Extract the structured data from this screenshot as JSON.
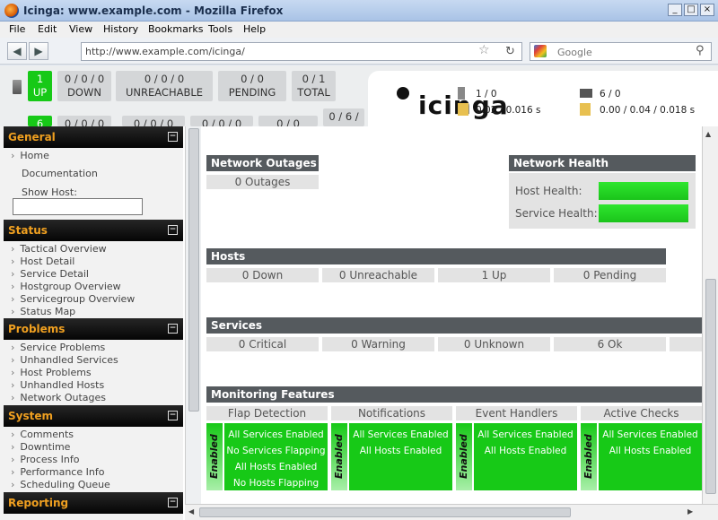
{
  "window": {
    "title": "Icinga: www.example.com - Mozilla Firefox"
  },
  "menubar": [
    "File",
    "Edit",
    "View",
    "History",
    "Bookmarks",
    "Tools",
    "Help"
  ],
  "nav": {
    "url": "http://www.example.com/icinga/",
    "search_placeholder": "Google"
  },
  "header": {
    "host_stats": [
      {
        "value": "1",
        "label": "UP"
      },
      {
        "value": "0 / 0 / 0",
        "label": "DOWN"
      },
      {
        "value": "0 / 0 / 0",
        "label": "UNREACHABLE"
      },
      {
        "value": "0 / 0",
        "label": "PENDING"
      },
      {
        "value": "0 / 1",
        "label": "TOTAL"
      }
    ],
    "service_stats": [
      "6",
      "0 / 0 / 0",
      "0 / 0 / 0",
      "0 / 0 / 0",
      "0 / 0",
      "0 / 6 /"
    ],
    "logo": "icinga",
    "perf": {
      "hosts_checked": "1 / 0",
      "hosts_latency": "0.02 / 0.016 s",
      "services_checked": "6 / 0",
      "services_latency": "0.00 / 0.04 / 0.018 s"
    }
  },
  "sidebar": {
    "general": {
      "title": "General",
      "home": "Home",
      "documentation": "Documentation",
      "show_host": "Show Host:"
    },
    "status": {
      "title": "Status",
      "items": [
        "Tactical Overview",
        "Host Detail",
        "Service Detail",
        "Hostgroup Overview",
        "Servicegroup Overview",
        "Status Map"
      ]
    },
    "problems": {
      "title": "Problems",
      "items": [
        "Service Problems",
        "Unhandled Services",
        "Host Problems",
        "Unhandled Hosts",
        "Network Outages"
      ]
    },
    "system": {
      "title": "System",
      "items": [
        "Comments",
        "Downtime",
        "Process Info",
        "Performance Info",
        "Scheduling Queue"
      ]
    },
    "reporting": {
      "title": "Reporting"
    }
  },
  "main": {
    "network_outages": {
      "title": "Network Outages",
      "value": "0 Outages"
    },
    "network_health": {
      "title": "Network Health",
      "host_health": "Host Health:",
      "service_health": "Service Health:",
      "host_level": 1.0,
      "service_level": 1.0
    },
    "hosts": {
      "title": "Hosts",
      "cells": [
        "0 Down",
        "0 Unreachable",
        "1 Up",
        "0 Pending"
      ]
    },
    "services": {
      "title": "Services",
      "cells": [
        "0 Critical",
        "0 Warning",
        "0 Unknown",
        "6 Ok"
      ]
    },
    "monitoring": {
      "title": "Monitoring Features",
      "enabled_label": "Enabled",
      "features": [
        {
          "name": "Flap Detection",
          "lines": [
            "All Services Enabled",
            "No Services Flapping",
            "All Hosts Enabled",
            "No Hosts Flapping"
          ]
        },
        {
          "name": "Notifications",
          "lines": [
            "All Services Enabled",
            "All Hosts Enabled"
          ]
        },
        {
          "name": "Event Handlers",
          "lines": [
            "All Services Enabled",
            "All Hosts Enabled"
          ]
        },
        {
          "name": "Active Checks",
          "lines": [
            "All Services Enabled",
            "All Hosts Enabled"
          ]
        }
      ]
    }
  },
  "colors": {
    "ok_green": "#17c917",
    "section_orange": "#f0a020",
    "bar_grey": "#555a5e"
  }
}
